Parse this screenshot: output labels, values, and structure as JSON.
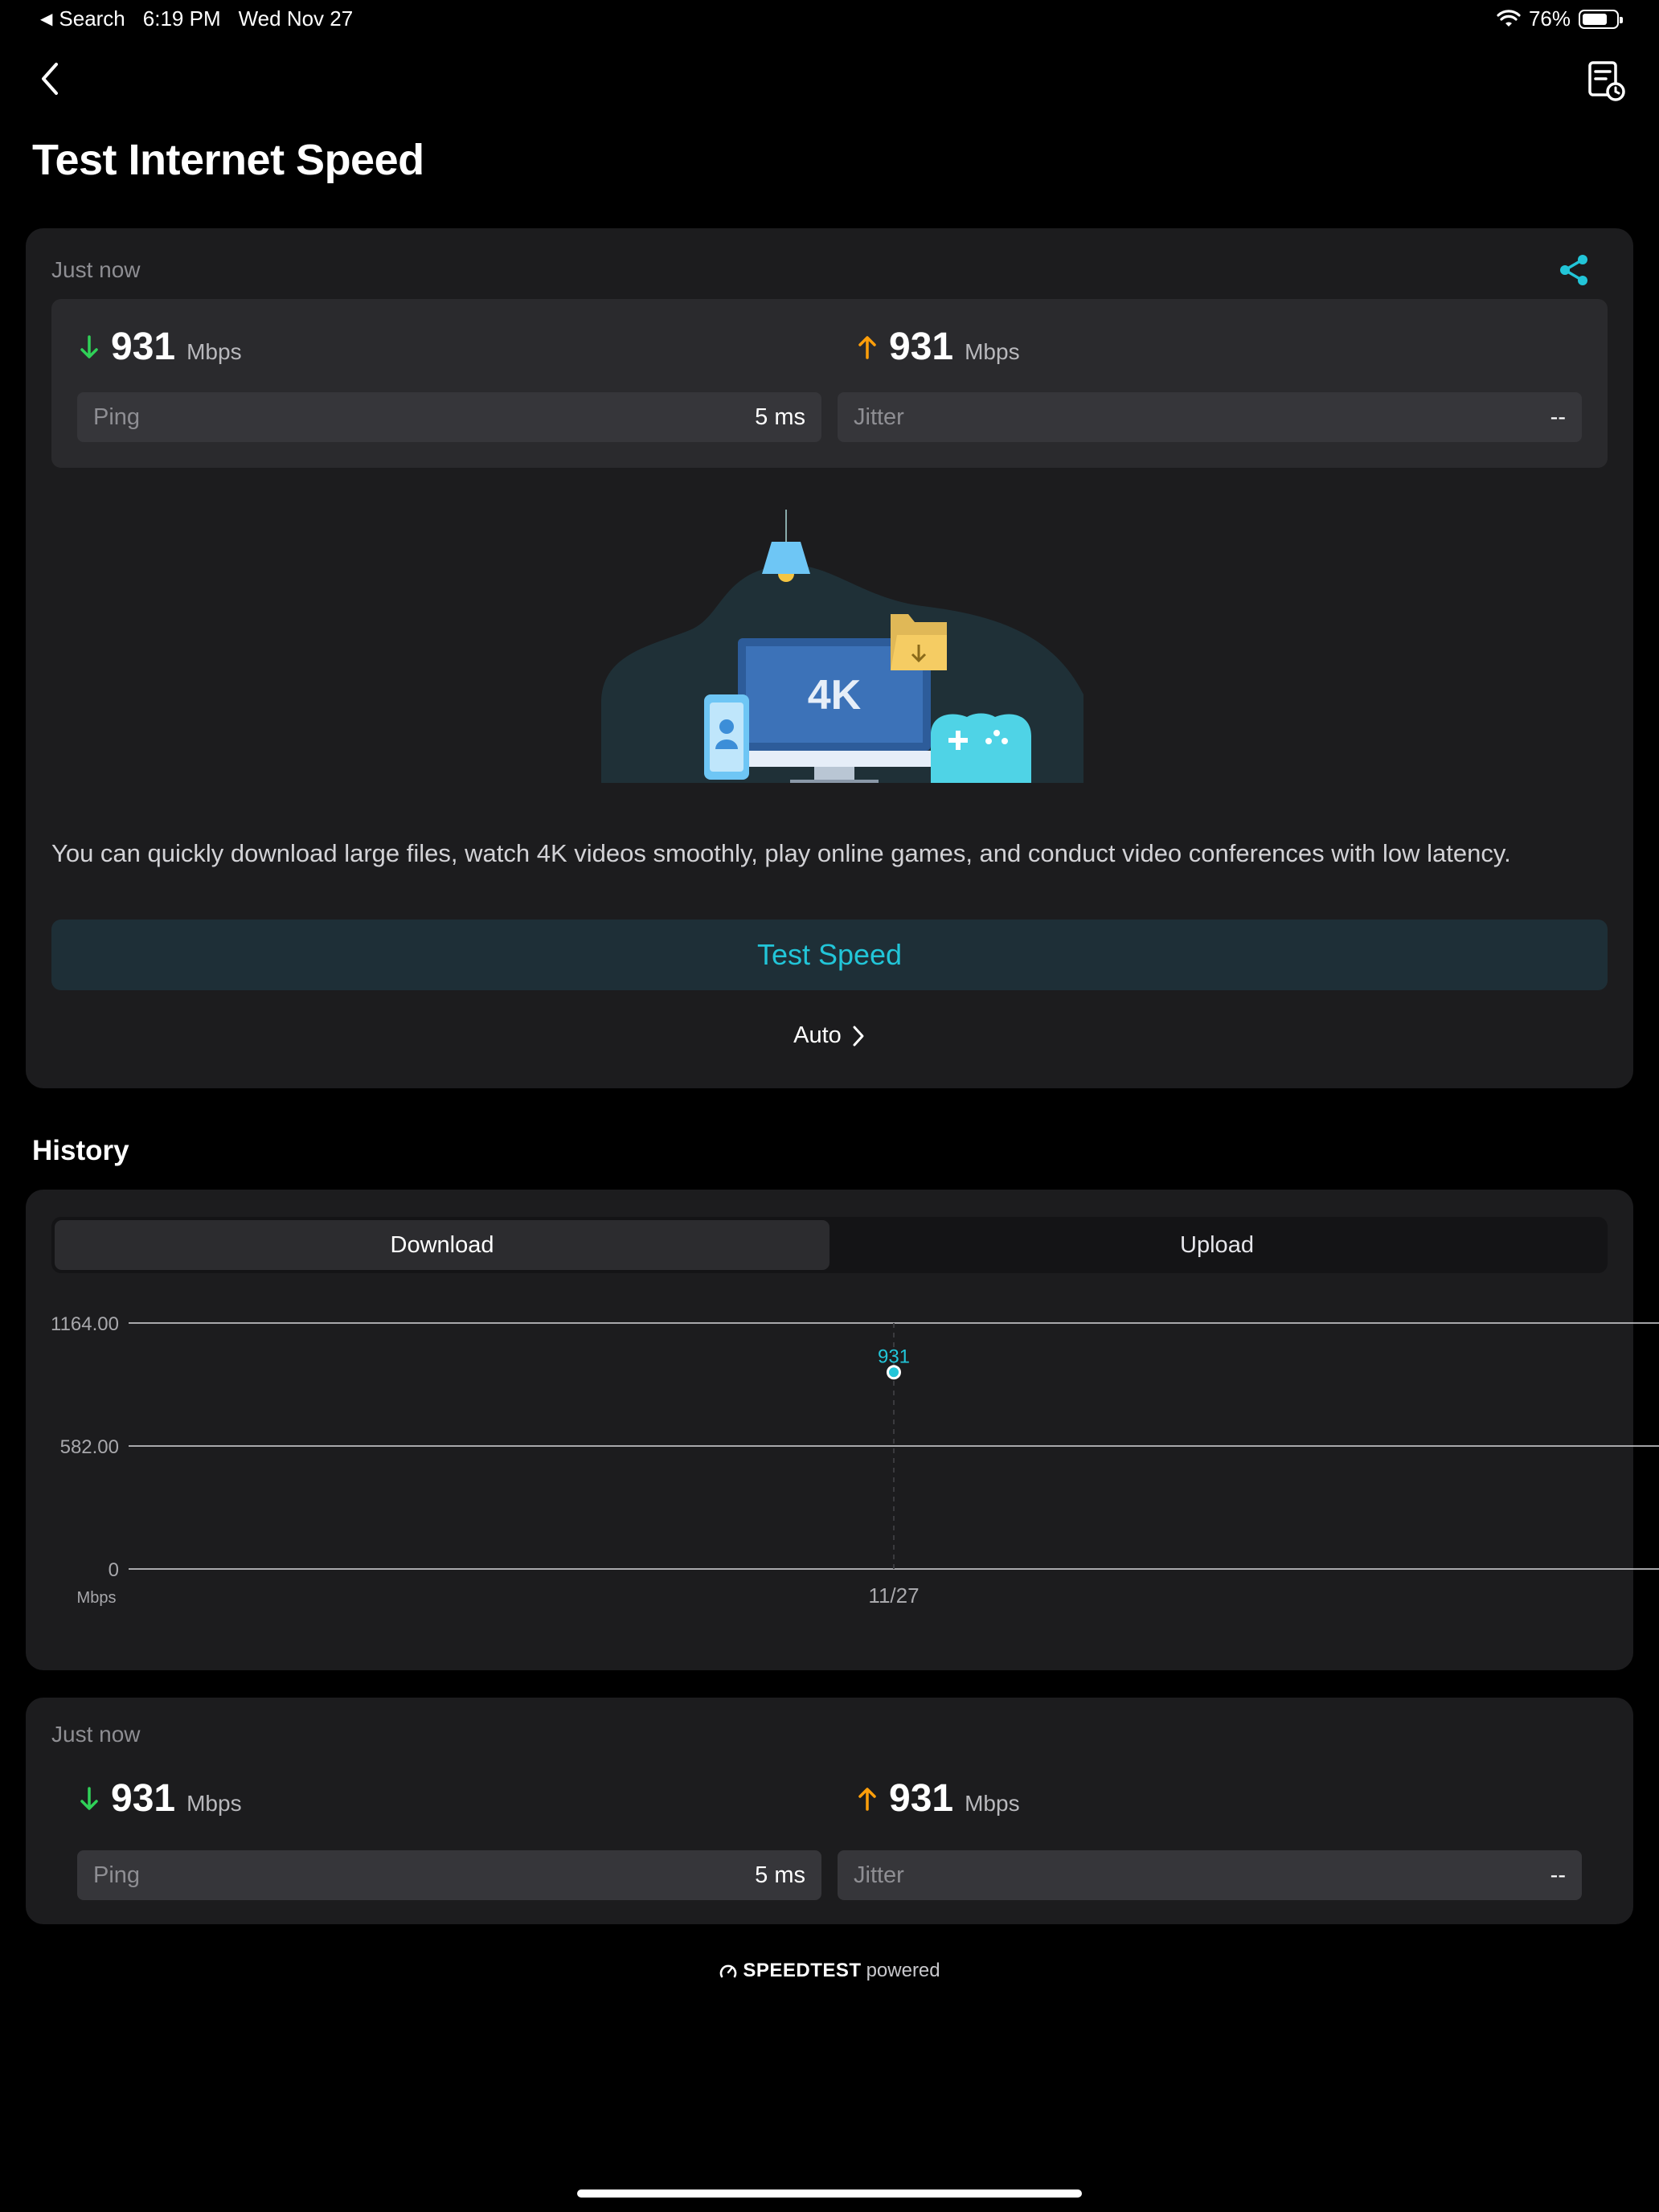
{
  "status_bar": {
    "back_app": "Search",
    "time": "6:19 PM",
    "date": "Wed Nov 27",
    "battery": "76%",
    "battery_level": 0.76
  },
  "page": {
    "title": "Test Internet Speed"
  },
  "latest_result": {
    "timestamp": "Just now",
    "download": {
      "value": "931",
      "unit": "Mbps"
    },
    "upload": {
      "value": "931",
      "unit": "Mbps"
    },
    "ping": {
      "label": "Ping",
      "value": "5 ms"
    },
    "jitter": {
      "label": "Jitter",
      "value": "--"
    }
  },
  "illustration": {
    "badge": "4K"
  },
  "description": "You can quickly download large files, watch 4K videos smoothly, play online games, and conduct video conferences with low latency.",
  "actions": {
    "test_speed": "Test Speed",
    "server": "Auto"
  },
  "history": {
    "title": "History",
    "tabs": [
      {
        "label": "Download",
        "active": true
      },
      {
        "label": "Upload",
        "active": false
      }
    ]
  },
  "chart_data": {
    "type": "scatter",
    "x": [
      "11/27"
    ],
    "series": [
      {
        "values": [
          931
        ]
      }
    ],
    "data_labels": [
      "931"
    ],
    "yticks": [
      "1164.00",
      "582.00",
      "0"
    ],
    "ylim": [
      0,
      1164
    ],
    "ylabel": "Mbps",
    "grid": true,
    "color": "#22c5d8"
  },
  "history_entry": {
    "timestamp": "Just now",
    "download": {
      "value": "931",
      "unit": "Mbps"
    },
    "upload": {
      "value": "931",
      "unit": "Mbps"
    },
    "ping": {
      "label": "Ping",
      "value": "5 ms"
    },
    "jitter": {
      "label": "Jitter",
      "value": "--"
    }
  },
  "footer": {
    "brand": "SPEEDTEST",
    "suffix": "powered"
  },
  "colors": {
    "accent": "#22c5d8",
    "download": "#30d158",
    "upload": "#ff9f0a",
    "card": "#1c1c1e"
  }
}
